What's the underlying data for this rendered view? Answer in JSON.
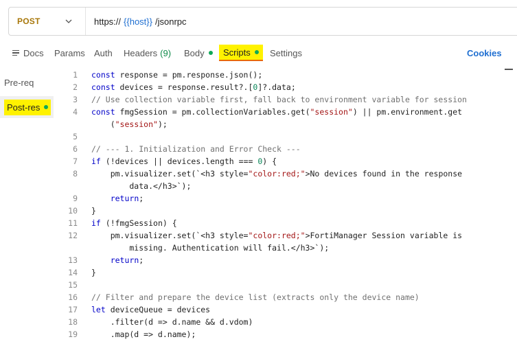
{
  "request": {
    "method": "POST",
    "url_prefix": "https://",
    "url_variable": "{{host}}",
    "url_suffix": "/jsonrpc"
  },
  "tabs": {
    "docs": "Docs",
    "params": "Params",
    "auth": "Auth",
    "headers": "Headers",
    "headers_count": "(9)",
    "body": "Body",
    "scripts": "Scripts",
    "settings": "Settings",
    "cookies": "Cookies"
  },
  "sidebar": {
    "pre": "Pre-req",
    "post": "Post-res"
  },
  "code": {
    "lines": [
      {
        "n": "1",
        "text": "const response = pm.response.json();"
      },
      {
        "n": "2",
        "text": "const devices = response.result?.[0]?.data;"
      },
      {
        "n": "3",
        "text": "// Use collection variable first, fall back to environment variable for session"
      },
      {
        "n": "4",
        "text": "const fmgSession = pm.collectionVariables.get(\"session\") || pm.environment.get"
      },
      {
        "n": "",
        "text": "    (\"session\");"
      },
      {
        "n": "5",
        "text": ""
      },
      {
        "n": "6",
        "text": "// --- 1. Initialization and Error Check ---"
      },
      {
        "n": "7",
        "text": "if (!devices || devices.length === 0) {"
      },
      {
        "n": "8",
        "text": "    pm.visualizer.set(`<h3 style=\"color:red;\">No devices found in the response"
      },
      {
        "n": "",
        "text": "        data.</h3>`);"
      },
      {
        "n": "9",
        "text": "    return;"
      },
      {
        "n": "10",
        "text": "}"
      },
      {
        "n": "11",
        "text": "if (!fmgSession) {"
      },
      {
        "n": "12",
        "text": "    pm.visualizer.set(`<h3 style=\"color:red;\">FortiManager Session variable is"
      },
      {
        "n": "",
        "text": "        missing. Authentication will fail.</h3>`);"
      },
      {
        "n": "13",
        "text": "    return;"
      },
      {
        "n": "14",
        "text": "}"
      },
      {
        "n": "15",
        "text": ""
      },
      {
        "n": "16",
        "text": "// Filter and prepare the device list (extracts only the device name)"
      },
      {
        "n": "17",
        "text": "let deviceQueue = devices"
      },
      {
        "n": "18",
        "text": "    .filter(d => d.name && d.vdom)"
      },
      {
        "n": "19",
        "text": "    .map(d => d.name);"
      }
    ]
  }
}
